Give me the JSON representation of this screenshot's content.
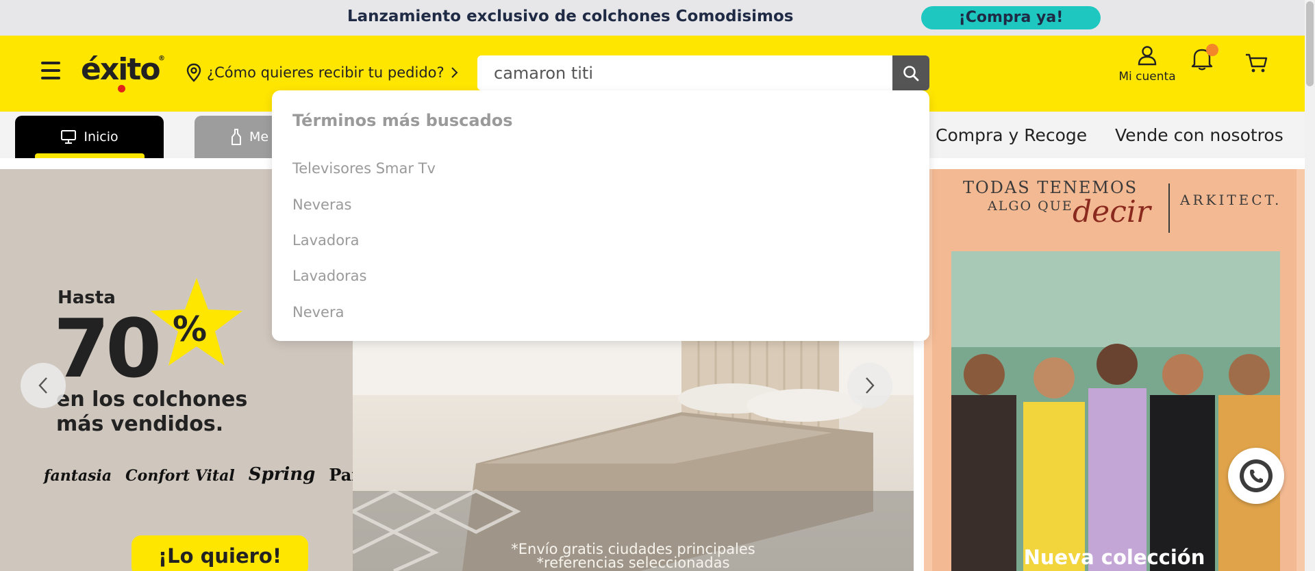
{
  "announcement": {
    "text": "Lanzamiento exclusivo de colchones Comodisimos",
    "cta": "¡Compra ya!"
  },
  "header": {
    "logo": "éxito",
    "delivery_prompt": "¿Cómo quieres recibir tu pedido?",
    "search": {
      "value": "camaron titi"
    },
    "account_label": "Mi cuenta"
  },
  "nav": {
    "tabs": [
      {
        "label": "Inicio",
        "icon": "monitor-icon",
        "active": true
      },
      {
        "label": "Me",
        "icon": "bottle-icon",
        "active": false
      }
    ],
    "links": [
      "Compra y Recoge",
      "Vende con nosotros"
    ]
  },
  "search_dropdown": {
    "title": "Términos más buscados",
    "items": [
      "Televisores Smar Tv",
      "Neveras",
      "Lavadora",
      "Lavadoras",
      "Nevera"
    ]
  },
  "hero": {
    "hasta": "Hasta",
    "discount": "70",
    "percent": "%",
    "line1": "en los colchones",
    "line2": "más vendidos.",
    "brands": [
      "fantasia",
      "Confort Vital",
      "Spring",
      "Paraíso"
    ],
    "cta": "¡Lo quiero!",
    "disclaimer1": "*Envío gratis ciudades principales",
    "disclaimer2": "*referencias seleccionadas"
  },
  "side_banner": {
    "line1": "TODAS TENEMOS",
    "line2": "ALGO QUE",
    "accent": "decir",
    "brand": "ARKITECT.",
    "cta": "Nueva colección"
  },
  "colors": {
    "brand_yellow": "#ffe600",
    "announce_cta": "#1fc7c1",
    "notification_dot": "#f4862a",
    "logo_dot": "#e2231a"
  }
}
